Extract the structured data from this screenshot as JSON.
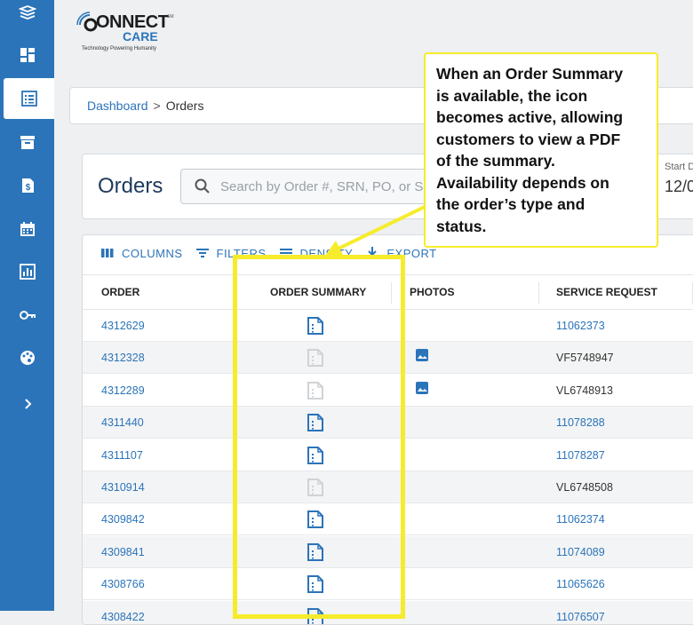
{
  "sidebar": {
    "items": [
      {
        "icon": "layers-icon"
      },
      {
        "icon": "dashboard-icon"
      },
      {
        "icon": "list-icon",
        "active": true
      },
      {
        "icon": "archive-icon"
      },
      {
        "icon": "invoice-icon"
      },
      {
        "icon": "calendar-icon"
      },
      {
        "icon": "report-icon"
      },
      {
        "icon": "key-icon"
      },
      {
        "icon": "palette-icon"
      },
      {
        "icon": "chevron-right-icon"
      }
    ]
  },
  "logo": {
    "word1": "ONNECT",
    "word2": "CARE",
    "mark": "SM",
    "tagline": "Technology Powering Humanity"
  },
  "breadcrumb": {
    "root": "Dashboard",
    "separator": ">",
    "current": "Orders"
  },
  "header": {
    "title": "Orders",
    "search_placeholder": "Search by Order #, SRN, PO, or S",
    "start_label": "Start D",
    "start_value": "12/0"
  },
  "toolbar": {
    "columns": "COLUMNS",
    "filters": "FILTERS",
    "density": "DENSITY",
    "export": "EXPORT"
  },
  "table": {
    "headers": {
      "order": "ORDER",
      "summary": "ORDER SUMMARY",
      "photos": "PHOTOS",
      "service": "SERVICE REQUEST"
    },
    "rows": [
      {
        "order": "4312629",
        "summary_active": true,
        "photo": false,
        "sr": "11062373",
        "sr_link": true
      },
      {
        "order": "4312328",
        "summary_active": false,
        "photo": true,
        "sr": "VF5748947",
        "sr_link": false
      },
      {
        "order": "4312289",
        "summary_active": false,
        "photo": true,
        "sr": "VL6748913",
        "sr_link": false
      },
      {
        "order": "4311440",
        "summary_active": true,
        "photo": false,
        "sr": "11078288",
        "sr_link": true
      },
      {
        "order": "4311107",
        "summary_active": true,
        "photo": false,
        "sr": "11078287",
        "sr_link": true
      },
      {
        "order": "4310914",
        "summary_active": false,
        "photo": false,
        "sr": "VL6748508",
        "sr_link": false
      },
      {
        "order": "4309842",
        "summary_active": true,
        "photo": false,
        "sr": "11062374",
        "sr_link": true
      },
      {
        "order": "4309841",
        "summary_active": true,
        "photo": false,
        "sr": "11074089",
        "sr_link": true
      },
      {
        "order": "4308766",
        "summary_active": true,
        "photo": false,
        "sr": "11065626",
        "sr_link": true
      },
      {
        "order": "4308422",
        "summary_active": true,
        "photo": false,
        "sr": "11076507",
        "sr_link": true
      }
    ]
  },
  "callout": {
    "lines": [
      "When an Order Summary",
      "is available, the icon",
      "becomes active, allowing",
      "customers to view a PDF",
      "of the summary.",
      "Availability depends on",
      "the order’s type and",
      "status."
    ]
  },
  "colors": {
    "brand": "#2b74b9",
    "highlight": "#f6ec2b",
    "icon_active": "#2b74b9",
    "icon_inactive": "#cfd3d6"
  }
}
